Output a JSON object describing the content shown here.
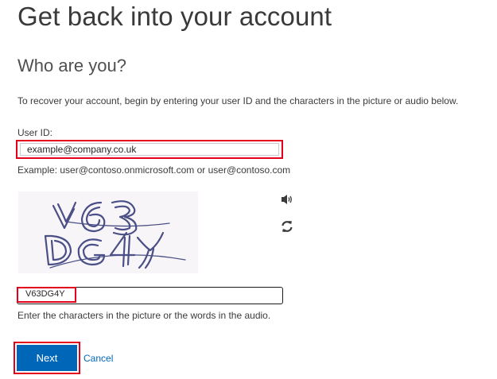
{
  "page": {
    "title": "Get back into your account",
    "section_title": "Who are you?",
    "instructions": "To recover your account, begin by entering your user ID and the characters in the picture or audio below."
  },
  "user_id": {
    "label": "User ID:",
    "value": "example@company.co.uk",
    "example": "Example: user@contoso.onmicrosoft.com or user@contoso.com"
  },
  "captcha": {
    "image_text": "V63DG4Y",
    "audio_icon": "speaker-icon",
    "refresh_icon": "refresh-icon",
    "input_value": "V63DG4Y",
    "help": "Enter the characters in the picture or the words in the audio."
  },
  "actions": {
    "next_label": "Next",
    "cancel_label": "Cancel"
  },
  "colors": {
    "accent": "#0067b8",
    "highlight": "#e3001b"
  }
}
